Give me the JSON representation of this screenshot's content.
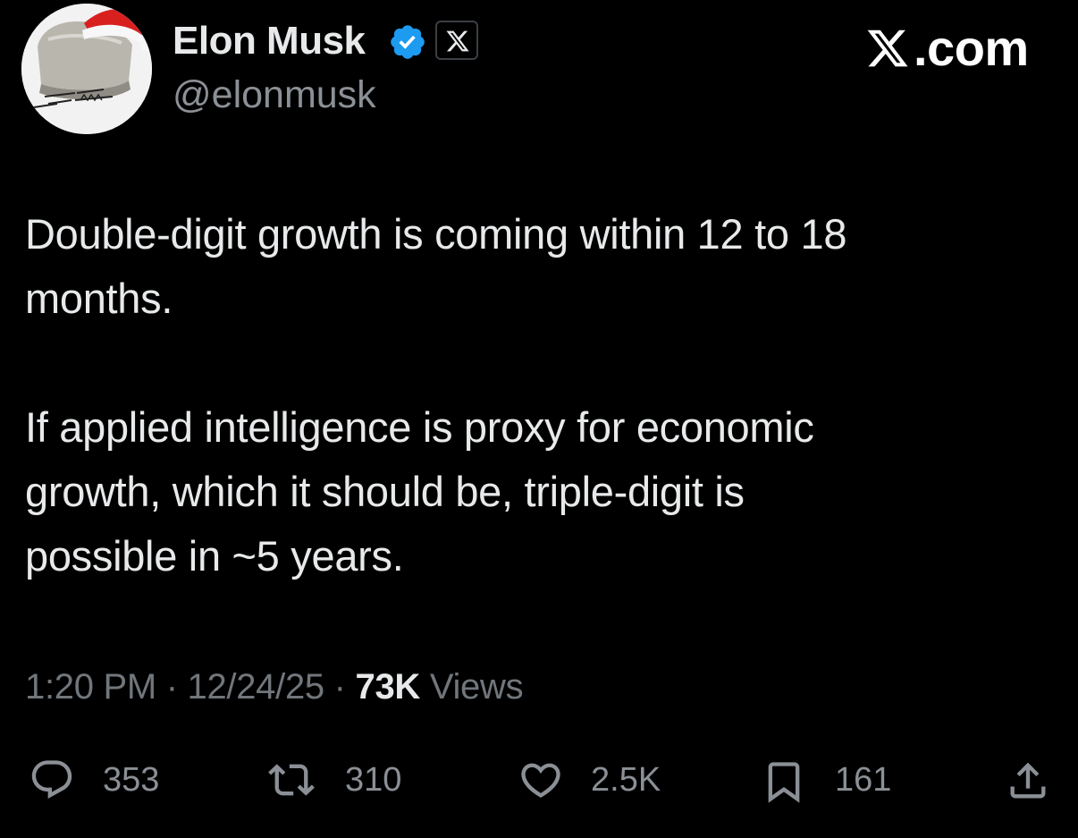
{
  "author": {
    "name": "Elon Musk",
    "handle": "@elonmusk",
    "verified_icon": "verified-badge-icon",
    "affiliate_icon": "x-logo-icon",
    "avatar_icon": "avatar-image"
  },
  "brand": {
    "mark_icon": "x-logo-icon",
    "text": ".com"
  },
  "tweet": {
    "paragraphs": [
      "Double-digit growth is coming within 12 to 18\nmonths.",
      "If applied intelligence is proxy for economic\ngrowth, which it should be, triple-digit is\npossible in ~5 years."
    ]
  },
  "meta": {
    "time": "1:20 PM",
    "separator": " · ",
    "date": "12/24/25",
    "views_count": "73K",
    "views_label": "Views"
  },
  "actions": {
    "reply": {
      "icon": "reply-icon",
      "count": "353"
    },
    "repost": {
      "icon": "repost-icon",
      "count": "310"
    },
    "like": {
      "icon": "heart-icon",
      "count": "2.5K"
    },
    "bookmark": {
      "icon": "bookmark-icon",
      "count": "161"
    },
    "share": {
      "icon": "share-icon"
    }
  },
  "colors": {
    "background": "#000000",
    "primary_text": "#e7e9ea",
    "secondary_text": "#71767b",
    "verified_blue": "#1d9bf0"
  }
}
